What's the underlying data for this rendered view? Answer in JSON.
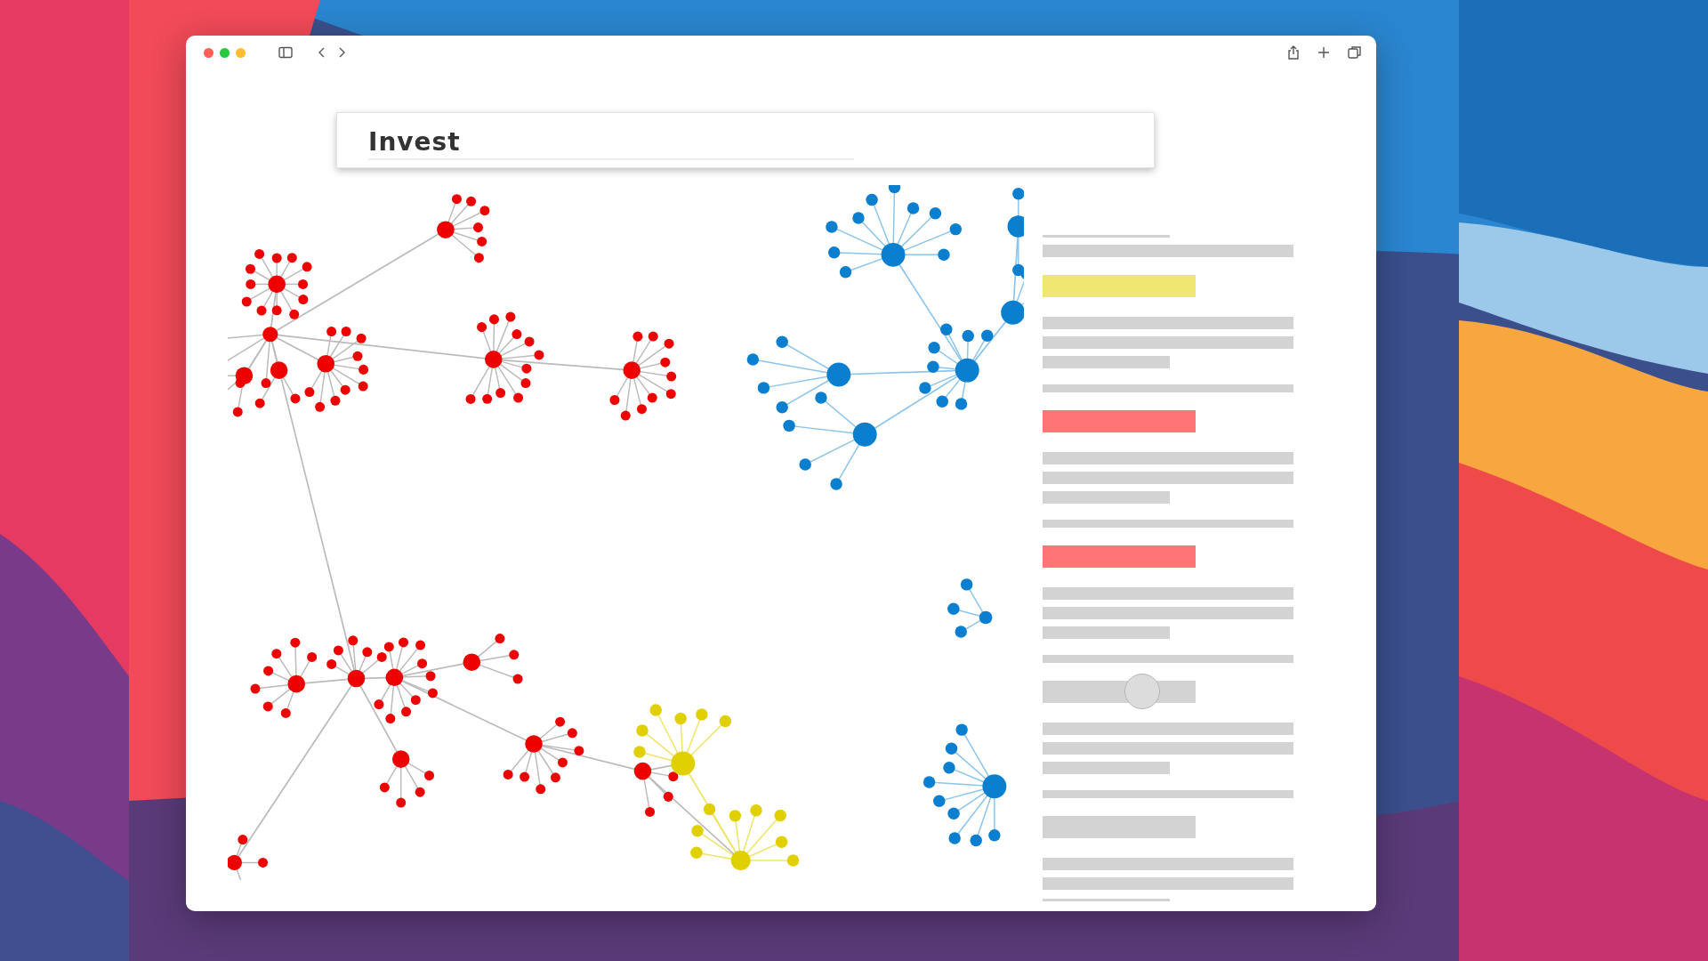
{
  "window": {
    "controls": [
      {
        "color": "#ff5f57"
      },
      {
        "color": "#28c840"
      },
      {
        "color": "#febc2e"
      }
    ]
  },
  "search": {
    "value": "Invest"
  },
  "panel": {
    "items": [
      {
        "kind": "rule-short"
      },
      {
        "kind": "bar"
      },
      {
        "kind": "tag",
        "color": "#f0e672"
      },
      {
        "kind": "bar"
      },
      {
        "kind": "bar"
      },
      {
        "kind": "bar-short"
      },
      {
        "kind": "rule"
      },
      {
        "kind": "tag",
        "color": "#ff7474"
      },
      {
        "kind": "bar"
      },
      {
        "kind": "bar"
      },
      {
        "kind": "bar-short"
      },
      {
        "kind": "rule"
      },
      {
        "kind": "tag",
        "color": "#ff7474"
      },
      {
        "kind": "bar"
      },
      {
        "kind": "bar"
      },
      {
        "kind": "bar-short"
      },
      {
        "kind": "rule"
      },
      {
        "kind": "slider",
        "level": 0.65
      },
      {
        "kind": "bar"
      },
      {
        "kind": "bar"
      },
      {
        "kind": "bar-short"
      },
      {
        "kind": "rule"
      },
      {
        "kind": "tag",
        "color": "#d3d3d3"
      },
      {
        "kind": "bar"
      },
      {
        "kind": "bar"
      },
      {
        "kind": "rule-short"
      }
    ]
  }
}
